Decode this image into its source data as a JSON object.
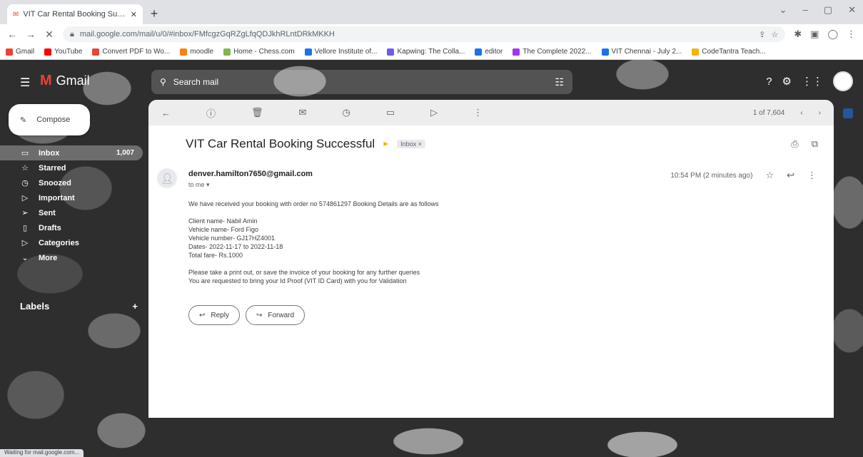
{
  "browser": {
    "tab_title": "VIT Car Rental Booking Successful",
    "new_tab": "+",
    "url": "mail.google.com/mail/u/0/#inbox/FMfcgzGqRZgLfqQDJkhRLntDRkMKKH",
    "bookmarks": [
      {
        "label": "Gmail",
        "color": "#ea4335"
      },
      {
        "label": "YouTube",
        "color": "#ff0000"
      },
      {
        "label": "Convert PDF to Wo...",
        "color": "#e8453c"
      },
      {
        "label": "moodle",
        "color": "#f98012"
      },
      {
        "label": "Home - Chess.com",
        "color": "#81b64c"
      },
      {
        "label": "Vellore Institute of...",
        "color": "#1a73e8"
      },
      {
        "label": "Kapwing: The Colla...",
        "color": "#6c5ce7"
      },
      {
        "label": "editor",
        "color": "#1a73e8"
      },
      {
        "label": "The Complete 2022...",
        "color": "#a435f0"
      },
      {
        "label": "VIT Chennai - July 2...",
        "color": "#1a73e8"
      },
      {
        "label": "CodeTantra Teach...",
        "color": "#f4b400"
      }
    ]
  },
  "gmail": {
    "logo_text": "Gmail",
    "search_placeholder": "Search mail",
    "compose_label": "Compose",
    "nav": [
      {
        "label": "Inbox",
        "count": "1,007",
        "icon": "inbox-icon",
        "glyph": "▭"
      },
      {
        "label": "Starred",
        "count": "",
        "icon": "star-icon",
        "glyph": "☆"
      },
      {
        "label": "Snoozed",
        "count": "",
        "icon": "clock-icon",
        "glyph": "◷"
      },
      {
        "label": "Important",
        "count": "",
        "icon": "label-important-icon",
        "glyph": "▷"
      },
      {
        "label": "Sent",
        "count": "",
        "icon": "send-icon",
        "glyph": "➢"
      },
      {
        "label": "Drafts",
        "count": "",
        "icon": "draft-icon",
        "glyph": "▯"
      },
      {
        "label": "Categories",
        "count": "",
        "icon": "label-icon",
        "glyph": "▷"
      },
      {
        "label": "More",
        "count": "",
        "icon": "chevron-down-icon",
        "glyph": "⌄"
      }
    ],
    "labels_heading": "Labels",
    "labels_add": "+"
  },
  "email": {
    "pager": "1 of 7,604",
    "subject": "VIT Car Rental Booking Successful",
    "inbox_chip": "Inbox ×",
    "sender": "denver.hamilton7650@gmail.com",
    "to_me": "to me ▾",
    "time": "10:54 PM (2 minutes ago)",
    "body": {
      "intro": "We have received your booking with order no 574861297 Booking Details are as follows",
      "client": "Client name- Nabil Amin",
      "vehicle_name": "Vehicle name- Ford Figo",
      "vehicle_number": "Vehicle number- GJ17HZ4001",
      "dates": "Dates- 2022-11-17 to 2022-11-18",
      "fare": "Total fare- Rs.1000",
      "note1": "Please take a print out, or save the invoice of your booking for any further queries",
      "note2": "You are requested to bring your Id Proof (VIT ID Card) with you for Validation"
    },
    "reply_label": "Reply",
    "forward_label": "Forward"
  },
  "status_text": "Waiting for mail.google.com..."
}
